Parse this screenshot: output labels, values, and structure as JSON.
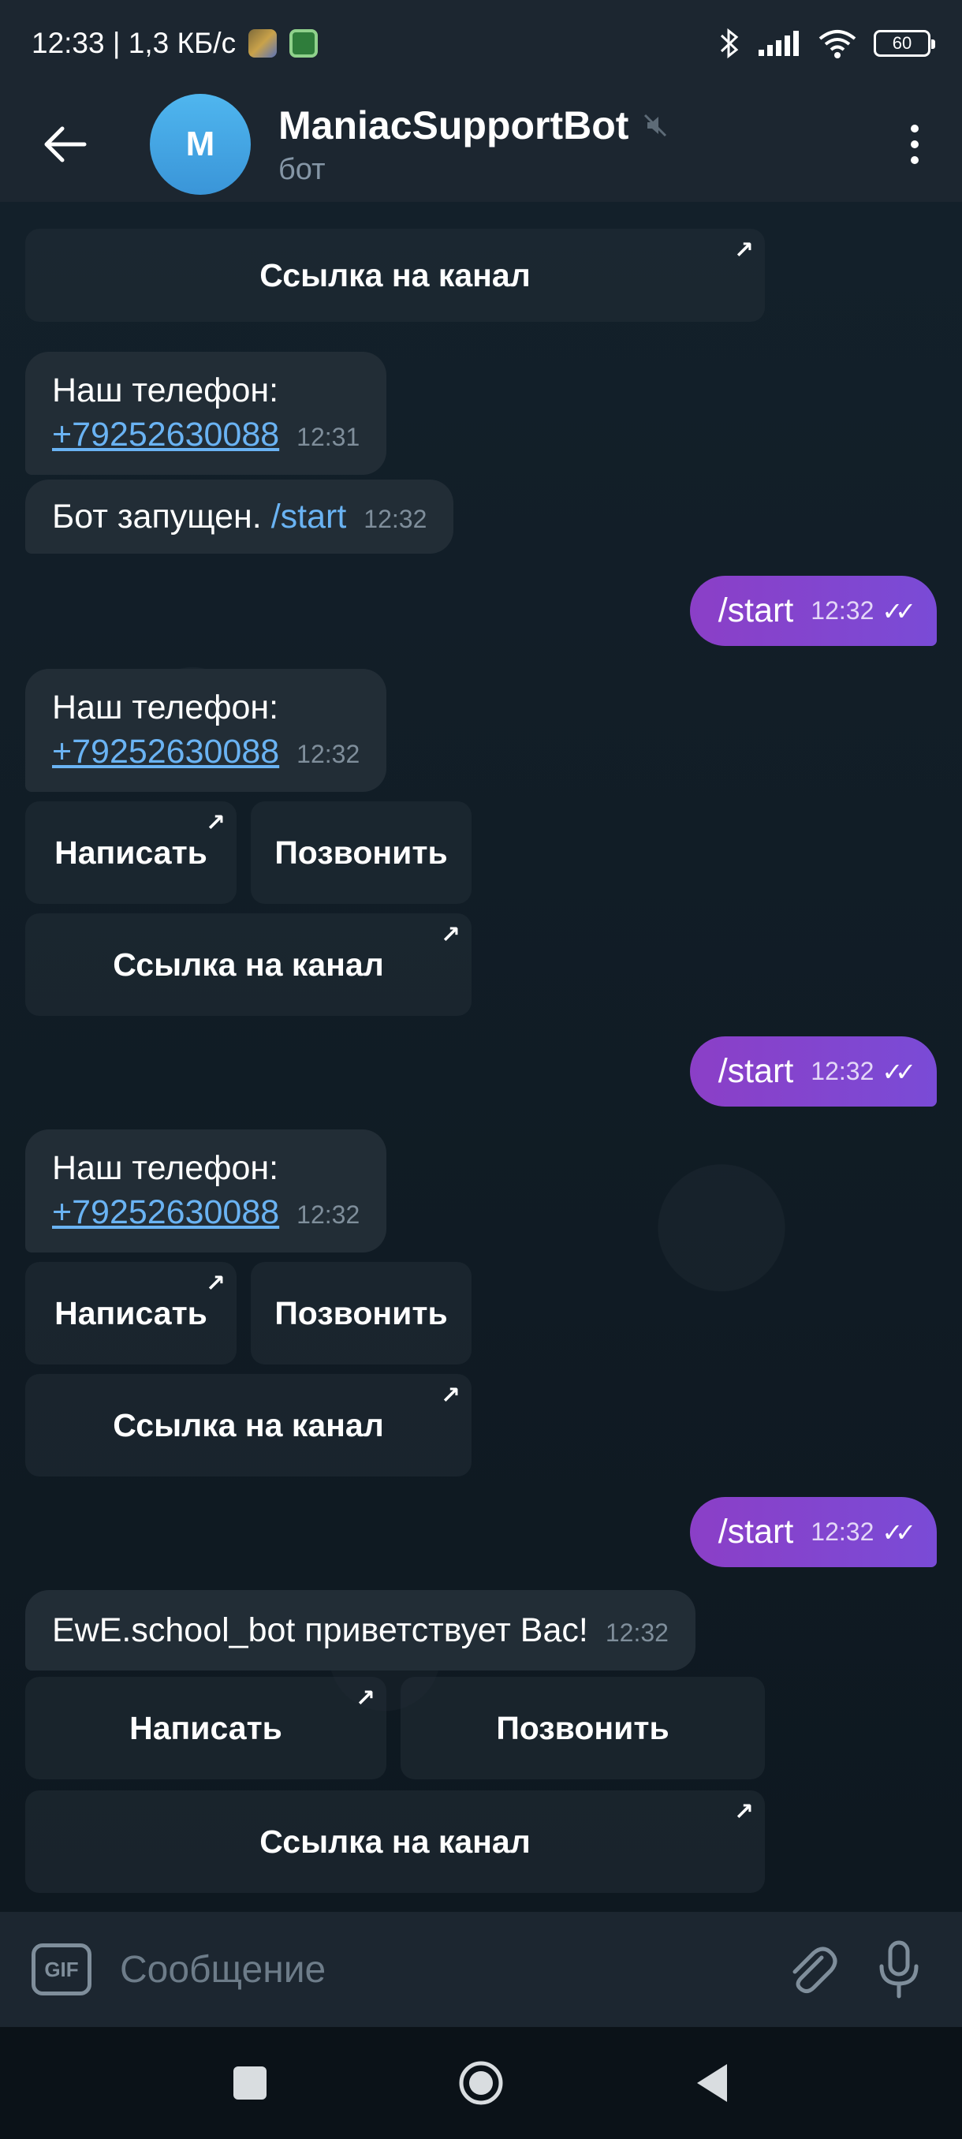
{
  "status_bar": {
    "time_speed": "12:33 | 1,3 КБ/с",
    "battery": "60"
  },
  "header": {
    "avatar_letter": "M",
    "title": "ManiacSupportBot",
    "subtitle": "бот"
  },
  "messages": {
    "m0_button": "Ссылка на канал",
    "m1_text": "Наш телефон:",
    "m1_phone": "+79252630088",
    "m1_time": "12:31",
    "m2_text": "Бот запущен.",
    "m2_cmd": "/start",
    "m2_time": "12:32",
    "o1_text": "/start",
    "o1_time": "12:32",
    "m3_text": "Наш телефон:",
    "m3_phone": "+79252630088",
    "m3_time": "12:32",
    "o2_text": "/start",
    "o2_time": "12:32",
    "m4_text": "Наш телефон:",
    "m4_phone": "+79252630088",
    "m4_time": "12:32",
    "o3_text": "/start",
    "o3_time": "12:32",
    "m5_text": "EwE.school_bot приветствует Вас!",
    "m5_time": "12:32"
  },
  "buttons": {
    "write": "Написать",
    "call": "Позвонить",
    "channel": "Ссылка на канал"
  },
  "input": {
    "gif_label": "GIF",
    "placeholder": "Сообщение"
  }
}
